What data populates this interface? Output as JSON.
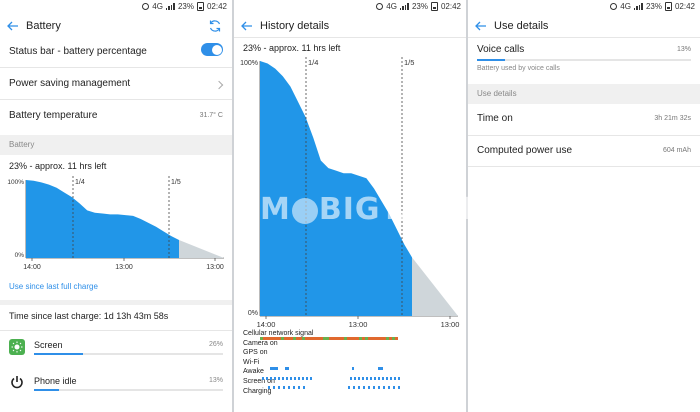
{
  "status_bar": {
    "signal": "4G",
    "battery": "23%",
    "time": "02:42"
  },
  "colors": {
    "accent": "#2f8fe8",
    "chart_fill": "#2196e8",
    "prediction": "#cfd6da",
    "signal_orange": "#e0692e",
    "signal_green": "#6ab04c"
  },
  "panel1": {
    "title": "Battery",
    "rows": {
      "status_bar_pct": "Status bar - battery percentage",
      "power_saving": "Power saving management",
      "battery_temp": "Battery temperature",
      "battery_temp_value": "31.7° C"
    },
    "section": "Battery",
    "estimate": "23% - approx. 11 hrs left",
    "chart": {
      "y_top": "100%",
      "y_bottom": "0%",
      "marker1": "1/4",
      "marker2": "1/5",
      "x_ticks": [
        "14:00",
        "13:00",
        "13:00"
      ]
    },
    "link": "Use since last full charge",
    "time_since": "Time since last charge: 1d 13h 43m 58s",
    "usage": [
      {
        "label": "Screen",
        "pct": "26%",
        "value": 0.26,
        "icon": "brightness-icon"
      },
      {
        "label": "Phone idle",
        "pct": "13%",
        "value": 0.13,
        "icon": "power-icon"
      }
    ]
  },
  "panel2": {
    "title": "History details",
    "estimate": "23% - approx. 11 hrs left",
    "chart": {
      "y_top": "100%",
      "y_bottom": "0%",
      "marker1": "1/4",
      "marker2": "1/5",
      "x_ticks": [
        "14:00",
        "13:00",
        "13:00"
      ]
    },
    "signals": [
      "Cellular network signal",
      "Camera on",
      "GPS on",
      "Wi-Fi",
      "Awake",
      "Screen on",
      "Charging"
    ]
  },
  "panel3": {
    "title": "Use details",
    "voice_calls": "Voice calls",
    "voice_pct": "13%",
    "voice_value": 0.13,
    "voice_sub": "Battery used by voice calls",
    "section": "Use details",
    "time_on_label": "Time on",
    "time_on_value": "3h 21m 32s",
    "computed_label": "Computed power use",
    "computed_value": "604 mAh"
  },
  "chart_data": [
    {
      "type": "area",
      "title": "23% - approx. 11 hrs left",
      "x_ticks": [
        "14:00",
        "13:00",
        "13:00"
      ],
      "ylim": [
        0,
        100
      ],
      "annotations": [
        "1/4",
        "1/5"
      ],
      "series": [
        {
          "values": [
            100,
            99,
            97,
            94,
            90,
            84,
            78,
            70,
            61,
            58,
            57,
            56,
            56,
            55,
            54,
            50,
            45,
            40,
            34,
            28,
            23
          ]
        }
      ]
    },
    {
      "type": "area",
      "title": "23% - approx. 11 hrs left",
      "x_ticks": [
        "14:00",
        "13:00",
        "13:00"
      ],
      "ylim": [
        0,
        100
      ],
      "annotations": [
        "1/4",
        "1/5"
      ],
      "series": [
        {
          "values": [
            100,
            99,
            97,
            94,
            90,
            84,
            78,
            70,
            61,
            58,
            57,
            56,
            56,
            55,
            54,
            50,
            45,
            40,
            34,
            28,
            23
          ]
        }
      ]
    }
  ]
}
